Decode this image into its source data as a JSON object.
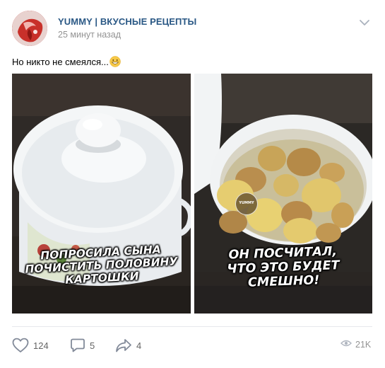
{
  "post": {
    "group_name": "YUMMY | ВКУСНЫЕ РЕЦЕПТЫ",
    "time": "25 минут назад",
    "text": "Но никто не смеялся...",
    "emoji": "grinning-face-emoji"
  },
  "images": {
    "left_caption_line1": "ПОПРОСИЛА СЫНА",
    "left_caption_line2": "ПОЧИСТИТЬ ПОЛОВИНУ",
    "left_caption_line3": "КАРТОШКИ",
    "right_caption_line1": "ОН ПОСЧИТАЛ,",
    "right_caption_line2": "ЧТО ЭТО БУДЕТ",
    "right_caption_line3": "СМЕШНО!",
    "watermark": "YUMMY"
  },
  "actions": {
    "likes": "124",
    "comments": "5",
    "shares": "4",
    "views": "21K"
  },
  "icons": {
    "like": "heart-icon",
    "comment": "comment-bubble-icon",
    "share": "share-arrow-icon",
    "views": "eye-icon",
    "more": "chevron-down-icon"
  },
  "colors": {
    "link": "#2a5885",
    "muted": "#939393",
    "icon": "#828a99"
  }
}
